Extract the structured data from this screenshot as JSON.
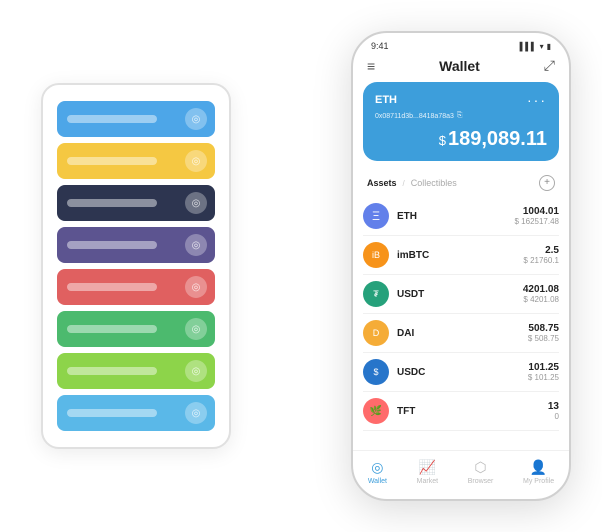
{
  "status_bar": {
    "time": "9:41",
    "signal": "▌▌▌",
    "wifi": "WiFi",
    "battery": "🔋"
  },
  "header": {
    "title": "Wallet",
    "menu_icon": "≡",
    "expand_icon": "⤢"
  },
  "wallet_card": {
    "label": "ETH",
    "address": "0x08711d3b...8418a78a3",
    "copy_icon": "⎘",
    "dots": "···",
    "balance_symbol": "$",
    "balance": "189,089.11"
  },
  "assets_header": {
    "tab_active": "Assets",
    "tab_divider": "/",
    "tab_inactive": "Collectibles",
    "add_icon": "+"
  },
  "assets": [
    {
      "icon": "Ξ",
      "icon_class": "icon-eth",
      "name": "ETH",
      "amount": "1004.01",
      "usd": "$ 162517.48"
    },
    {
      "icon": "₿",
      "icon_class": "icon-imbtc",
      "name": "imBTC",
      "amount": "2.5",
      "usd": "$ 21760.1"
    },
    {
      "icon": "₮",
      "icon_class": "icon-usdt",
      "name": "USDT",
      "amount": "4201.08",
      "usd": "$ 4201.08"
    },
    {
      "icon": "◈",
      "icon_class": "icon-dai",
      "name": "DAI",
      "amount": "508.75",
      "usd": "$ 508.75"
    },
    {
      "icon": "$",
      "icon_class": "icon-usdc",
      "name": "USDC",
      "amount": "101.25",
      "usd": "$ 101.25"
    },
    {
      "icon": "🌿",
      "icon_class": "icon-tft",
      "name": "TFT",
      "amount": "13",
      "usd": "0"
    }
  ],
  "bottom_nav": [
    {
      "label": "Wallet",
      "icon": "◎",
      "active": true
    },
    {
      "label": "Market",
      "icon": "📊",
      "active": false
    },
    {
      "label": "Browser",
      "icon": "👥",
      "active": false
    },
    {
      "label": "My Profile",
      "icon": "👤",
      "active": false
    }
  ],
  "card_stack": [
    {
      "color": "card-blue"
    },
    {
      "color": "card-yellow"
    },
    {
      "color": "card-dark"
    },
    {
      "color": "card-purple"
    },
    {
      "color": "card-red"
    },
    {
      "color": "card-green"
    },
    {
      "color": "card-lightgreen"
    },
    {
      "color": "card-lightblue"
    }
  ]
}
